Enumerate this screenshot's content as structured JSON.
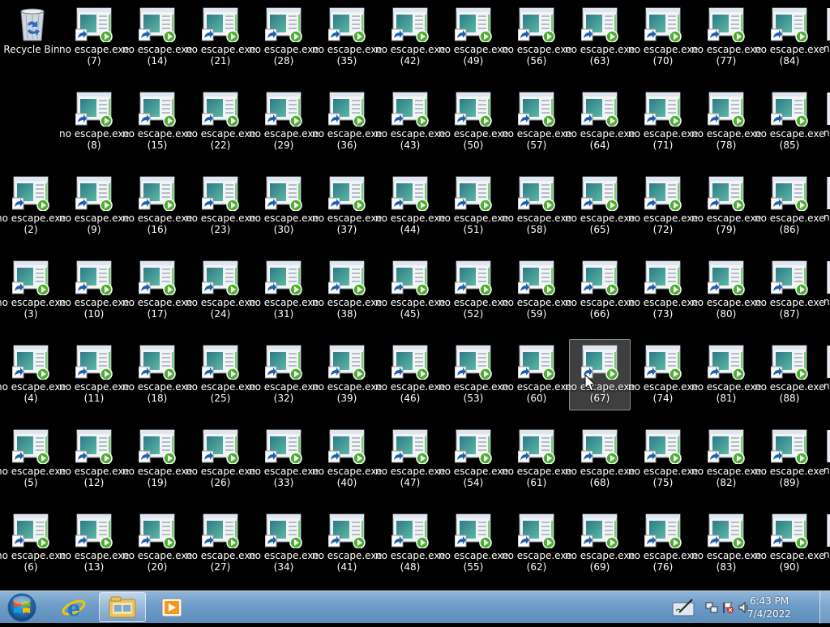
{
  "desktop": {
    "recycle_bin": {
      "label": "Recycle Bin",
      "icon": "recycle-bin-icon"
    },
    "shortcut_name": "no escape.exe",
    "shortcut_icon": "application-shortcut-icon",
    "columns": [
      [
        "(7)",
        "(14)",
        "(21)",
        "(28)",
        "(35)",
        "(42)",
        "(49)",
        "(56)",
        "(63)",
        "(70)",
        "(77)",
        "(84)"
      ],
      [
        "(8)",
        "(15)",
        "(22)",
        "(29)",
        "(36)",
        "(43)",
        "(50)",
        "(57)",
        "(64)",
        "(71)",
        "(78)",
        "(85)"
      ],
      [
        "(2)",
        "(9)",
        "(16)",
        "(23)",
        "(30)",
        "(37)",
        "(44)",
        "(51)",
        "(58)",
        "(65)",
        "(72)",
        "(79)",
        "(86)"
      ],
      [
        "(3)",
        "(10)",
        "(17)",
        "(24)",
        "(31)",
        "(38)",
        "(45)",
        "(52)",
        "(59)",
        "(66)",
        "(73)",
        "(80)",
        "(87)"
      ],
      [
        "(4)",
        "(11)",
        "(18)",
        "(25)",
        "(32)",
        "(39)",
        "(46)",
        "(53)",
        "(60)",
        "(67)",
        "(74)",
        "(81)",
        "(88)"
      ],
      [
        "(5)",
        "(12)",
        "(19)",
        "(26)",
        "(33)",
        "(40)",
        "(47)",
        "(54)",
        "(61)",
        "(68)",
        "(75)",
        "(82)",
        "(89)"
      ],
      [
        "(6)",
        "(13)",
        "(20)",
        "(27)",
        "(34)",
        "(41)",
        "(48)",
        "(55)",
        "(62)",
        "(69)",
        "(76)",
        "(83)",
        "(90)"
      ]
    ],
    "partial_label": "n",
    "selected": "(67)"
  },
  "taskbar": {
    "start_icon": "windows-start-orb-icon",
    "pinned": [
      {
        "name": "internet-explorer",
        "icon": "internet-explorer-icon"
      },
      {
        "name": "windows-explorer",
        "icon": "folder-icon"
      },
      {
        "name": "windows-media-player",
        "icon": "media-player-icon"
      }
    ],
    "tray": {
      "icons": [
        "action-center-icon",
        "network-icon",
        "flag-icon",
        "volume-icon"
      ],
      "time": "6:43 PM",
      "date": "7/4/2022"
    }
  },
  "colors": {
    "desktop_bg": "#000000",
    "taskbar": "#6f9dc8",
    "selection": "#8c8c8c"
  }
}
